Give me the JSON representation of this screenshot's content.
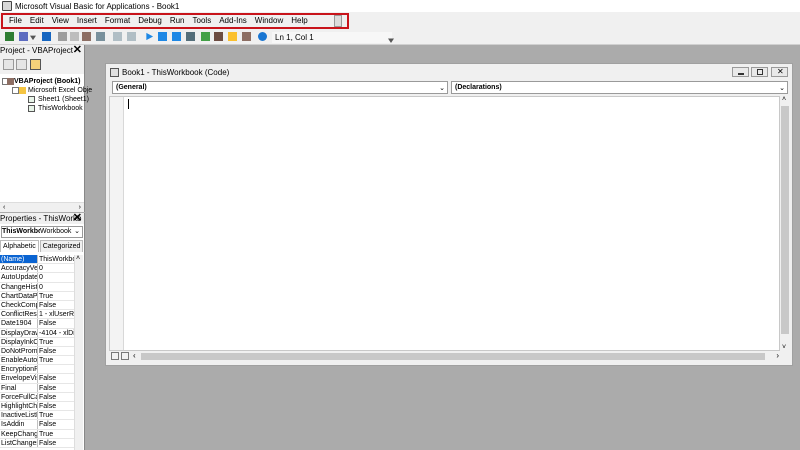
{
  "window": {
    "title": "Microsoft Visual Basic for Applications - Book1"
  },
  "menu": {
    "items": [
      "File",
      "Edit",
      "View",
      "Insert",
      "Format",
      "Debug",
      "Run",
      "Tools",
      "Add-Ins",
      "Window",
      "Help"
    ]
  },
  "toolbar": {
    "cursor_position": "Ln 1, Col 1"
  },
  "project": {
    "title": "Project - VBAProject",
    "close": "✕",
    "tree": {
      "root": "VBAProject (Book1)",
      "folder": "Microsoft Excel Obje",
      "sheet": "Sheet1 (Sheet1)",
      "workbook": "ThisWorkbook"
    }
  },
  "properties": {
    "title": "Properties - ThisWorkb",
    "close": "✕",
    "object_name": "ThisWorkbo",
    "object_type": "Workbook",
    "tabs": [
      "Alphabetic",
      "Categorized"
    ],
    "rows": [
      {
        "name": "(Name)",
        "value": "ThisWorkbo"
      },
      {
        "name": "AccuracyVers",
        "value": "0"
      },
      {
        "name": "AutoUpdateF",
        "value": "0"
      },
      {
        "name": "ChangeHistor",
        "value": "0"
      },
      {
        "name": "ChartDataPoi",
        "value": "True"
      },
      {
        "name": "CheckCompa",
        "value": "False"
      },
      {
        "name": "ConflictResol",
        "value": "1 - xlUserRe"
      },
      {
        "name": "Date1904",
        "value": "False"
      },
      {
        "name": "DisplayDrawi",
        "value": "-4104 - xlDi"
      },
      {
        "name": "DisplayInkCo",
        "value": "True"
      },
      {
        "name": "DoNotPromp",
        "value": "False"
      },
      {
        "name": "EnableAutoR",
        "value": "True"
      },
      {
        "name": "EncryptionPr",
        "value": ""
      },
      {
        "name": "EnvelopeVisil",
        "value": "False"
      },
      {
        "name": "Final",
        "value": "False"
      },
      {
        "name": "ForceFullCalc",
        "value": "False"
      },
      {
        "name": "HighlightChai",
        "value": "False"
      },
      {
        "name": "InactiveListB",
        "value": "True"
      },
      {
        "name": "IsAddin",
        "value": "False"
      },
      {
        "name": "KeepChangeH",
        "value": "True"
      },
      {
        "name": "ListChangesC",
        "value": "False"
      }
    ]
  },
  "code_window": {
    "title": "Book1 - ThisWorkbook (Code)",
    "object_combo": "(General)",
    "procedure_combo": "(Declarations)"
  },
  "colors": {
    "menu_highlight": "#c8141b",
    "selection": "#0a64d2",
    "workspace": "#ababab"
  }
}
